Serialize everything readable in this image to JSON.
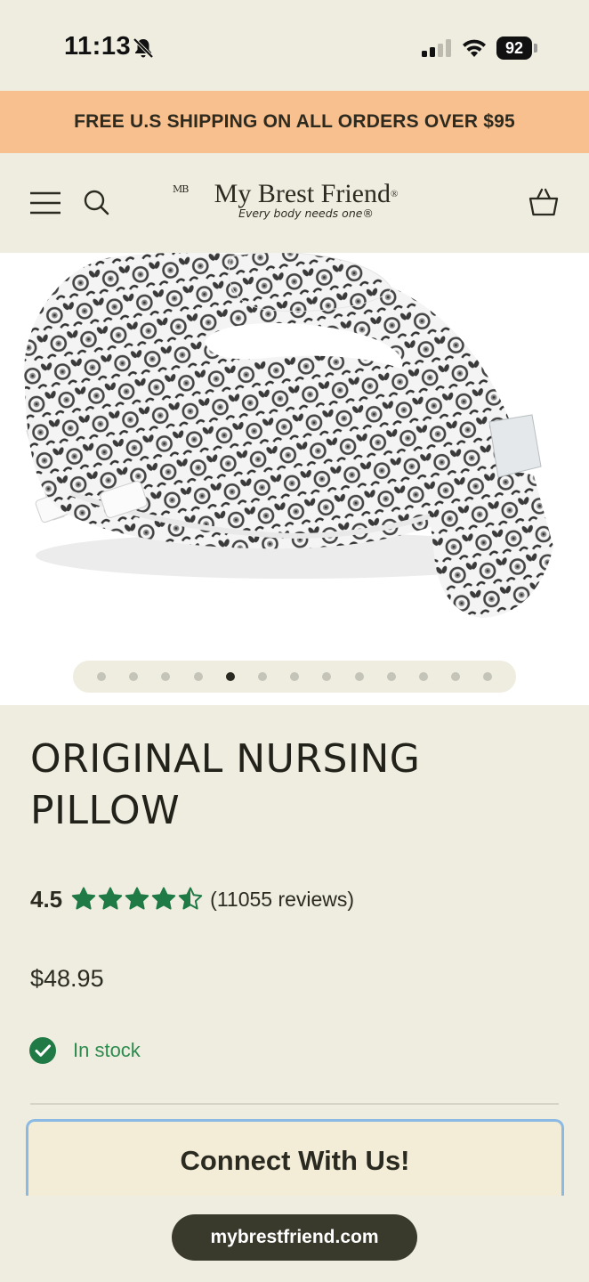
{
  "status_bar": {
    "time": "11:13",
    "battery": "92",
    "icons": [
      "bell-slash-icon",
      "signal-icon",
      "wifi-icon",
      "battery-icon"
    ]
  },
  "promo": {
    "text": "FREE U.S SHIPPING ON ALL ORDERS OVER $95",
    "background": "#f8c08f"
  },
  "header": {
    "logo_mark": "MB",
    "logo_name": "My Brest Friend",
    "logo_reg": "®",
    "tagline": "Every body needs one®",
    "icons": [
      "menu-icon",
      "search-icon",
      "cart-icon"
    ]
  },
  "gallery": {
    "slide_count": 13,
    "active_slide": 5
  },
  "product": {
    "title": "ORIGINAL NURSING PILLOW",
    "rating": "4.5",
    "rating_value": 4.5,
    "rating_max": 5,
    "reviews": "(11055 reviews)",
    "price": "$48.95",
    "stock": "In stock",
    "star_color": "#1f7a45",
    "stock_color": "#2e8b4e"
  },
  "connect": {
    "title": "Connect With Us!"
  },
  "browser": {
    "url": "mybrestfriend.com"
  }
}
